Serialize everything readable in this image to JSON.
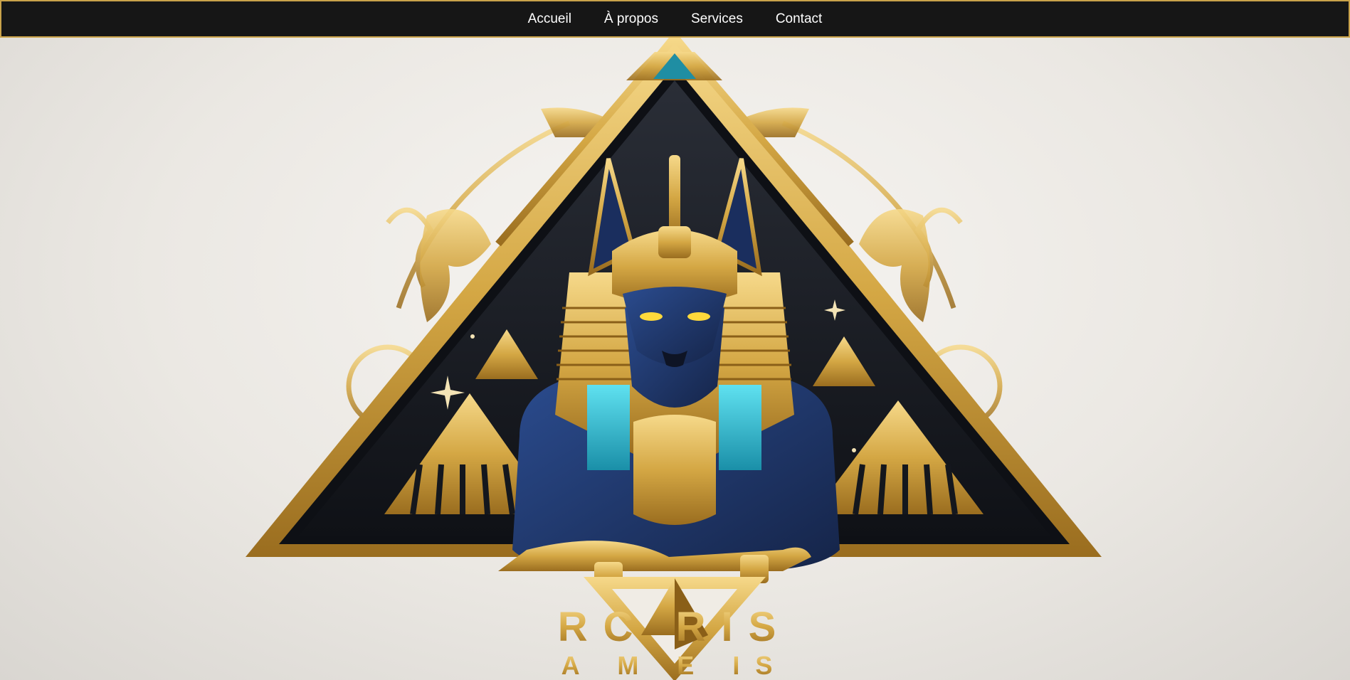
{
  "nav": {
    "items": [
      {
        "label": "Accueil"
      },
      {
        "label": "À propos"
      },
      {
        "label": "Services"
      },
      {
        "label": "Contact"
      }
    ]
  },
  "hero": {
    "image_icon": "anubis-pyramid-emblem",
    "logo_line1": "RC   RIS",
    "logo_line2": "A M  E IS",
    "colors": {
      "gold": "#d4a744",
      "navy": "#1f3566",
      "dark": "#14171d",
      "turquoise": "#2fb8d0",
      "nav_bg": "#161616",
      "nav_border": "#c9a24a"
    }
  }
}
